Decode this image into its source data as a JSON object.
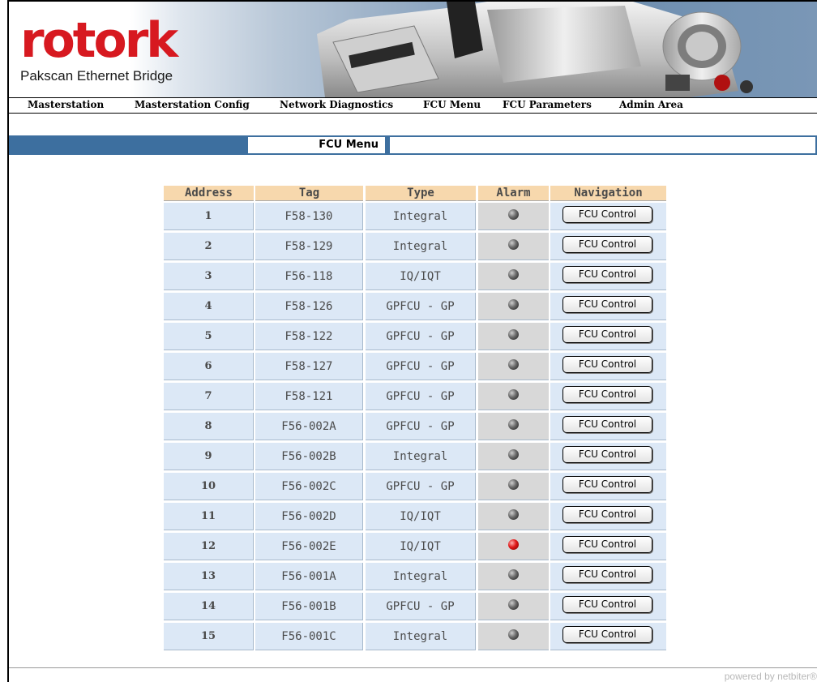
{
  "brand": {
    "logo": "rotork",
    "subtitle": "Pakscan Ethernet Bridge"
  },
  "nav": [
    "Masterstation",
    "Masterstation Config",
    "Network Diagnostics",
    "FCU Menu",
    "FCU Parameters",
    "Admin Area"
  ],
  "page_title": "FCU Menu",
  "table": {
    "headers": [
      "Address",
      "Tag",
      "Type",
      "Alarm",
      "Navigation"
    ],
    "button_label": "FCU Control",
    "rows": [
      {
        "address": "1",
        "tag": "F58-130",
        "type": "Integral",
        "alarm": false
      },
      {
        "address": "2",
        "tag": "F58-129",
        "type": "Integral",
        "alarm": false
      },
      {
        "address": "3",
        "tag": "F56-118",
        "type": "IQ/IQT",
        "alarm": false
      },
      {
        "address": "4",
        "tag": "F58-126",
        "type": "GPFCU - GP",
        "alarm": false
      },
      {
        "address": "5",
        "tag": "F58-122",
        "type": "GPFCU - GP",
        "alarm": false
      },
      {
        "address": "6",
        "tag": "F58-127",
        "type": "GPFCU - GP",
        "alarm": false
      },
      {
        "address": "7",
        "tag": "F58-121",
        "type": "GPFCU - GP",
        "alarm": false
      },
      {
        "address": "8",
        "tag": "F56-002A",
        "type": "GPFCU - GP",
        "alarm": false
      },
      {
        "address": "9",
        "tag": "F56-002B",
        "type": "Integral",
        "alarm": false
      },
      {
        "address": "10",
        "tag": "F56-002C",
        "type": "GPFCU - GP",
        "alarm": false
      },
      {
        "address": "11",
        "tag": "F56-002D",
        "type": "IQ/IQT",
        "alarm": false
      },
      {
        "address": "12",
        "tag": "F56-002E",
        "type": "IQ/IQT",
        "alarm": true
      },
      {
        "address": "13",
        "tag": "F56-001A",
        "type": "Integral",
        "alarm": false
      },
      {
        "address": "14",
        "tag": "F56-001B",
        "type": "GPFCU - GP",
        "alarm": false
      },
      {
        "address": "15",
        "tag": "F56-001C",
        "type": "Integral",
        "alarm": false
      }
    ]
  },
  "footer": "powered by netbiter®",
  "colors": {
    "brand_red": "#d71920",
    "title_bar": "#3d6f9f",
    "header_cell": "#f7d8ad",
    "row_cell": "#dce8f6",
    "alarm_on": "#e01818",
    "alarm_off": "#3a3a3a"
  }
}
